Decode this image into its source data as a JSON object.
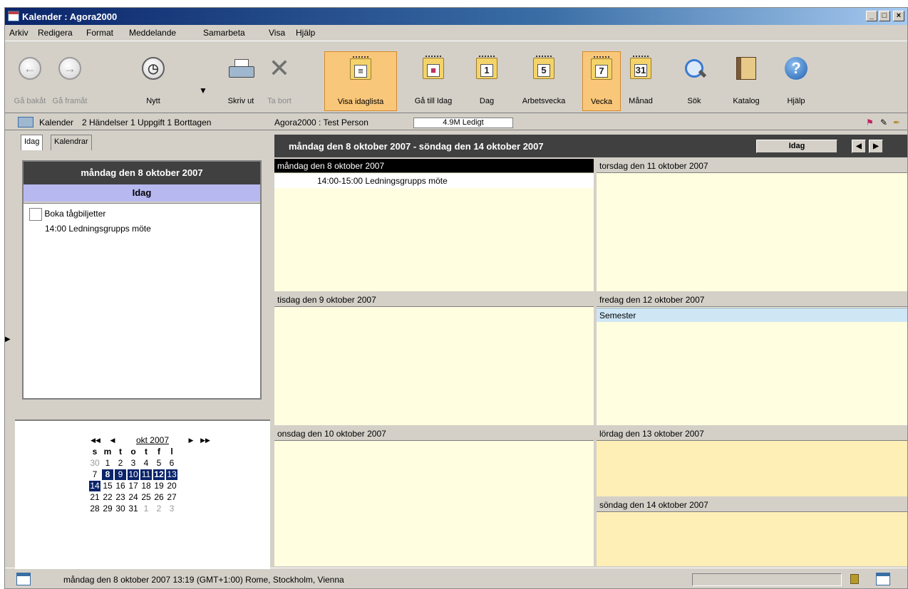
{
  "window": {
    "title": "Kalender : Agora2000"
  },
  "menu": [
    "Arkiv",
    "Redigera",
    "Format",
    "Meddelande",
    "Samarbeta",
    "Visa",
    "Hjälp"
  ],
  "toolbar": {
    "back": "Gå bakåt",
    "forward": "Gå framåt",
    "new": "Nytt",
    "print": "Skriv ut",
    "delete": "Ta bort",
    "agenda": "Visa idaglista",
    "goto_today": "Gå till Idag",
    "day": "Dag",
    "workweek": "Arbetsvecka",
    "week": "Vecka",
    "month": "Månad",
    "search": "Sök",
    "catalog": "Katalog",
    "help": "Hjälp",
    "day_num": "1",
    "workweek_num": "5",
    "week_num": "7",
    "month_num": "31"
  },
  "infobar": {
    "folder": "Kalender",
    "counts": "2 Händelser 1 Uppgift 1 Borttagen",
    "user": "Agora2000 : Test Person",
    "free": "4.9M Ledigt"
  },
  "left": {
    "tabs": [
      "Idag",
      "Kalendrar"
    ],
    "day_header": "måndag den 8 oktober 2007",
    "today_label": "Idag",
    "task": "Boka tågbiljetter",
    "event": "14:00 Ledningsgrupps möte"
  },
  "minical": {
    "month": "okt 2007",
    "nav": [
      "◀◀",
      "◀",
      "▶",
      "▶▶"
    ],
    "weekdays": [
      "s",
      "m",
      "t",
      "o",
      "t",
      "f",
      "l"
    ],
    "weeks": [
      [
        "30",
        "1",
        "2",
        "3",
        "4",
        "5",
        "6"
      ],
      [
        "7",
        "8",
        "9",
        "10",
        "11",
        "12",
        "13"
      ],
      [
        "14",
        "15",
        "16",
        "17",
        "18",
        "19",
        "20"
      ],
      [
        "21",
        "22",
        "23",
        "24",
        "25",
        "26",
        "27"
      ],
      [
        "28",
        "29",
        "30",
        "31",
        "1",
        "2",
        "3"
      ]
    ]
  },
  "week": {
    "title": "måndag den 8 oktober 2007 - söndag den 14 oktober 2007",
    "today_btn": "Idag",
    "prev": "◀",
    "next": "▶",
    "days": {
      "mon": "måndag den 8 oktober 2007",
      "tue": "tisdag den 9 oktober 2007",
      "wed": "onsdag den 10 oktober 2007",
      "thu": "torsdag den 11 oktober 2007",
      "fri": "fredag den 12 oktober 2007",
      "sat": "lördag den 13 oktober 2007",
      "sun": "söndag den 14 oktober 2007"
    },
    "mon_event": "14:00-15:00 Ledningsgrupps möte",
    "fri_event": "Semester"
  },
  "status": {
    "text": "måndag den 8 oktober 2007 13:19 (GMT+1:00) Rome, Stockholm, Vienna"
  },
  "colors": {
    "title": "#0a246a",
    "active_button": "#f9c77a",
    "day_bg": "#fffee0",
    "weekend_bg": "#fdefb6",
    "selected_week": "#0a246a"
  }
}
